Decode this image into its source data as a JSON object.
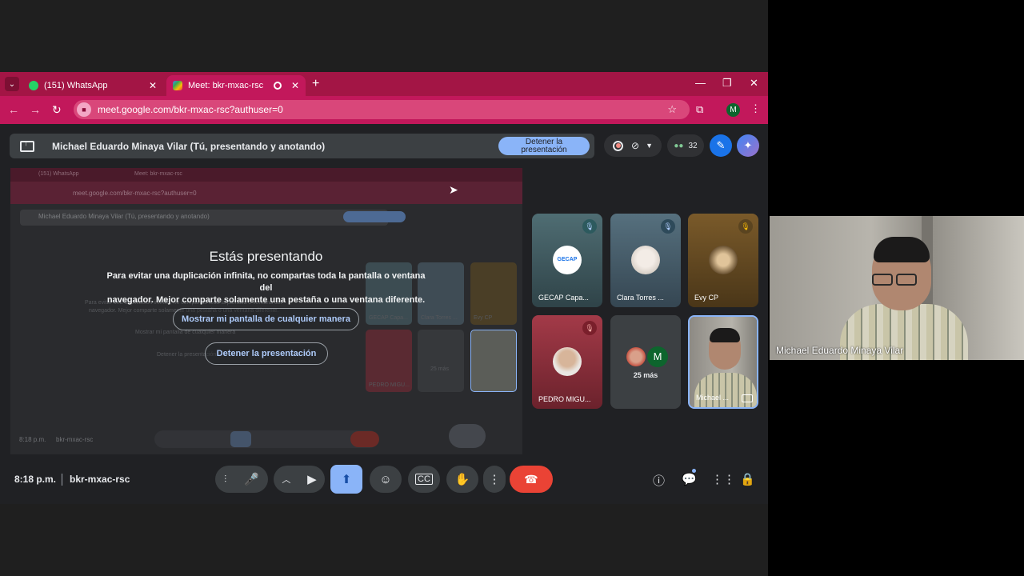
{
  "browser": {
    "tabs": [
      {
        "title": "(151) WhatsApp",
        "icon": "whatsapp-icon"
      },
      {
        "title": "Meet: bkr-mxac-rsc",
        "icon": "meet-icon"
      }
    ],
    "url": "meet.google.com/bkr-mxac-rsc?authuser=0",
    "profile_initial": "M",
    "theme_color": "#c2185b"
  },
  "banner": {
    "text": "Michael Eduardo Minaya Vilar (Tú, presentando y anotando)",
    "stop_label_1": "Detener la",
    "stop_label_2": "presentación",
    "participant_count": "32"
  },
  "presenting": {
    "title": "Estás presentando",
    "message_1": "Para evitar una duplicación infinita, no compartas toda la pantalla o ventana del",
    "message_2": "navegador. Mejor comparte solamente una pestaña o una ventana diferente.",
    "show_anyway": "Mostrar mi pantalla de cualquier manera",
    "stop": "Detener la presentación"
  },
  "preview": {
    "tab1": "(151) WhatsApp",
    "tab2": "Meet: bkr-mxac-rsc",
    "url": "meet.google.com/bkr-mxac-rsc?authuser=0",
    "banner": "Michael Eduardo Minaya Vilar (Tú, presentando y anotando)",
    "time": "8:18 p.m.",
    "code": "bkr-mxac-rsc",
    "dim1": "Para evitar una duplicación infinita, no compartas toda la pantalla o ventana del",
    "dim2": "navegador. Mejor comparte solamente una pestaña o una ventana diferente.",
    "dim3": "Mostrar mi pantalla de cualquier manera",
    "dim4": "Detener la presentación",
    "tiles": [
      "GECAP Capa...",
      "Clara Torres ...",
      "Evy CP",
      "PEDRO MIGU...",
      "25 más"
    ]
  },
  "participants": [
    {
      "name": "GECAP Capa...",
      "avatar_text": "GECAP",
      "muted": true
    },
    {
      "name": "Clara Torres ...",
      "muted": true
    },
    {
      "name": "Evy CP",
      "muted": true
    },
    {
      "name": "PEDRO MIGU...",
      "muted": true
    },
    {
      "name": "25 más",
      "initial": "M"
    },
    {
      "name": "Michael ..."
    }
  ],
  "toolbar": {
    "time": "8:18 p.m.",
    "meeting_code": "bkr-mxac-rsc"
  },
  "webcam": {
    "name": "Michael Eduardo Minaya Vilar"
  }
}
